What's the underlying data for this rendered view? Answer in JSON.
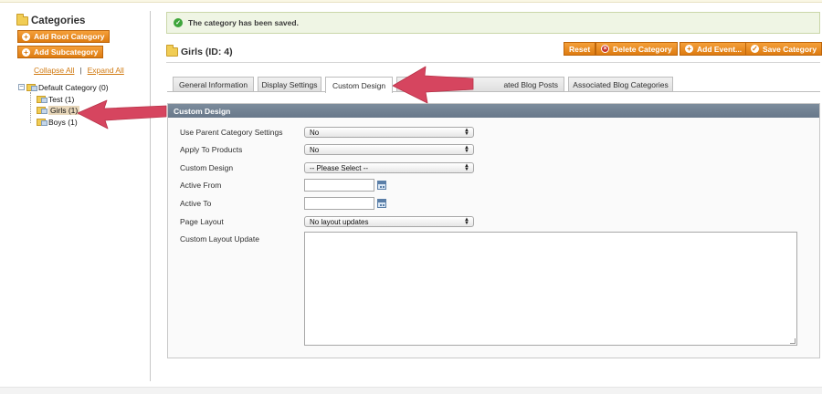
{
  "sidebar": {
    "title": "Categories",
    "add_root_label": "Add Root Category",
    "add_sub_label": "Add Subcategory",
    "collapse_label": "Collapse All",
    "separator": "|",
    "expand_label": "Expand All",
    "tree": {
      "root": "Default Category (0)",
      "children": [
        "Test (1)",
        "Girls (1)",
        "Boys (1)"
      ],
      "selected": "Girls (1)"
    }
  },
  "message": {
    "text": "The category has been saved."
  },
  "page": {
    "title": "Girls (ID: 4)"
  },
  "actions": {
    "reset": "Reset",
    "delete": "Delete Category",
    "add_event": "Add Event...",
    "save": "Save Category"
  },
  "tabs": [
    {
      "label": "General Information"
    },
    {
      "label": "Display Settings"
    },
    {
      "label": "Custom Design",
      "active": true
    },
    {
      "label": "ated Blog Posts"
    },
    {
      "label": "Associated Blog Categories"
    }
  ],
  "panel": {
    "title": "Custom Design",
    "fields": {
      "use_parent": {
        "label": "Use Parent Category Settings",
        "value": "No"
      },
      "apply_products": {
        "label": "Apply To Products",
        "value": "No"
      },
      "custom_design": {
        "label": "Custom Design",
        "value": "-- Please Select --"
      },
      "active_from": {
        "label": "Active From",
        "value": ""
      },
      "active_to": {
        "label": "Active To",
        "value": ""
      },
      "page_layout": {
        "label": "Page Layout",
        "value": "No layout updates"
      },
      "custom_layout": {
        "label": "Custom Layout Update",
        "value": ""
      }
    }
  },
  "colors": {
    "button_orange": "#e8890f",
    "panel_header": "#6e7e8f",
    "arrow": "#d6455f",
    "success_green": "#3da53a"
  }
}
